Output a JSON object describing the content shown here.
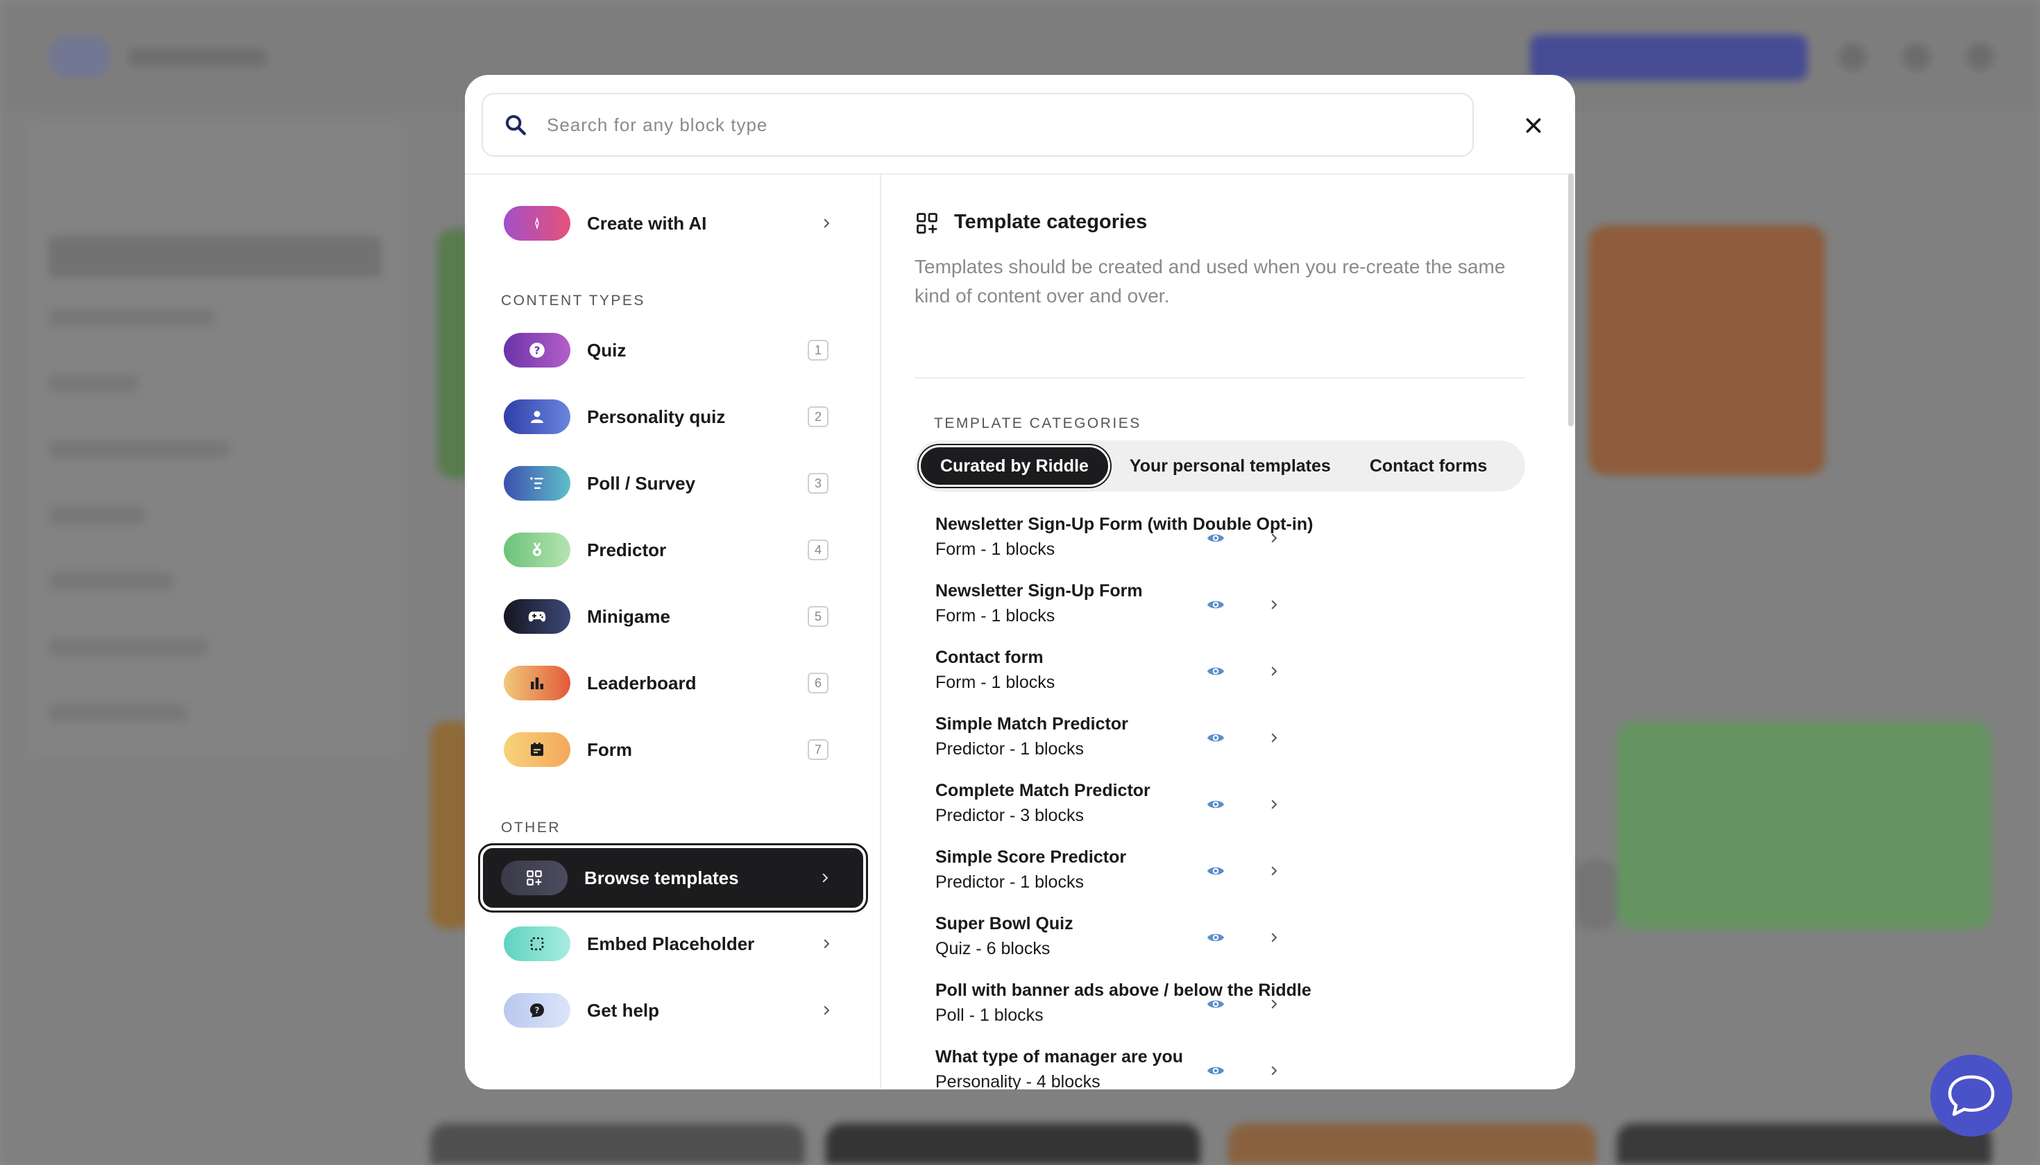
{
  "search": {
    "placeholder": "Search for any block type"
  },
  "menu": {
    "create_ai": "Create with AI",
    "content_types_label": "CONTENT TYPES",
    "content_types": [
      {
        "label": "Quiz",
        "shortcut": "1",
        "icon": "question-icon",
        "color": "#7b3fb0"
      },
      {
        "label": "Personality quiz",
        "shortcut": "2",
        "icon": "person-icon",
        "color": "#3a56c8"
      },
      {
        "label": "Poll / Survey",
        "shortcut": "3",
        "icon": "list-icon",
        "color": "#4b5fc0"
      },
      {
        "label": "Predictor",
        "shortcut": "4",
        "icon": "medal-icon",
        "color": "#7ecf8a"
      },
      {
        "label": "Minigame",
        "shortcut": "5",
        "icon": "gamepad-icon",
        "color": "#1c1c2c"
      },
      {
        "label": "Leaderboard",
        "shortcut": "6",
        "icon": "bar-chart-icon",
        "color": "#e67a3c"
      },
      {
        "label": "Form",
        "shortcut": "7",
        "icon": "form-icon",
        "color": "#f5c06a"
      }
    ],
    "other_label": "OTHER",
    "browse_templates": "Browse templates",
    "embed_placeholder": "Embed Placeholder",
    "get_help": "Get help"
  },
  "templates": {
    "title": "Template categories",
    "description": "Templates should be created and used when you re-create the same kind of content over and over.",
    "section_label": "TEMPLATE CATEGORIES",
    "tabs": [
      "Curated by Riddle",
      "Your personal templates",
      "Contact forms"
    ],
    "active_tab": "Curated by Riddle",
    "items": [
      {
        "name": "Newsletter Sign-Up Form (with Double Opt-in)",
        "meta": "Form - 1 blocks"
      },
      {
        "name": "Newsletter Sign-Up Form",
        "meta": "Form - 1 blocks"
      },
      {
        "name": "Contact form",
        "meta": "Form - 1 blocks"
      },
      {
        "name": "Simple Match Predictor",
        "meta": "Predictor - 1 blocks"
      },
      {
        "name": "Complete Match Predictor",
        "meta": "Predictor - 3 blocks"
      },
      {
        "name": "Simple Score Predictor",
        "meta": "Predictor - 1 blocks"
      },
      {
        "name": "Super Bowl Quiz",
        "meta": "Quiz - 6 blocks"
      },
      {
        "name": "Poll with banner ads above / below the Riddle",
        "meta": "Poll - 1 blocks"
      },
      {
        "name": "What type of manager are you",
        "meta": "Personality - 4 blocks"
      }
    ]
  },
  "colors": {
    "accent": "#4a52c8",
    "active_dark": "#1c1c1e",
    "eye": "#5a8fc8"
  }
}
